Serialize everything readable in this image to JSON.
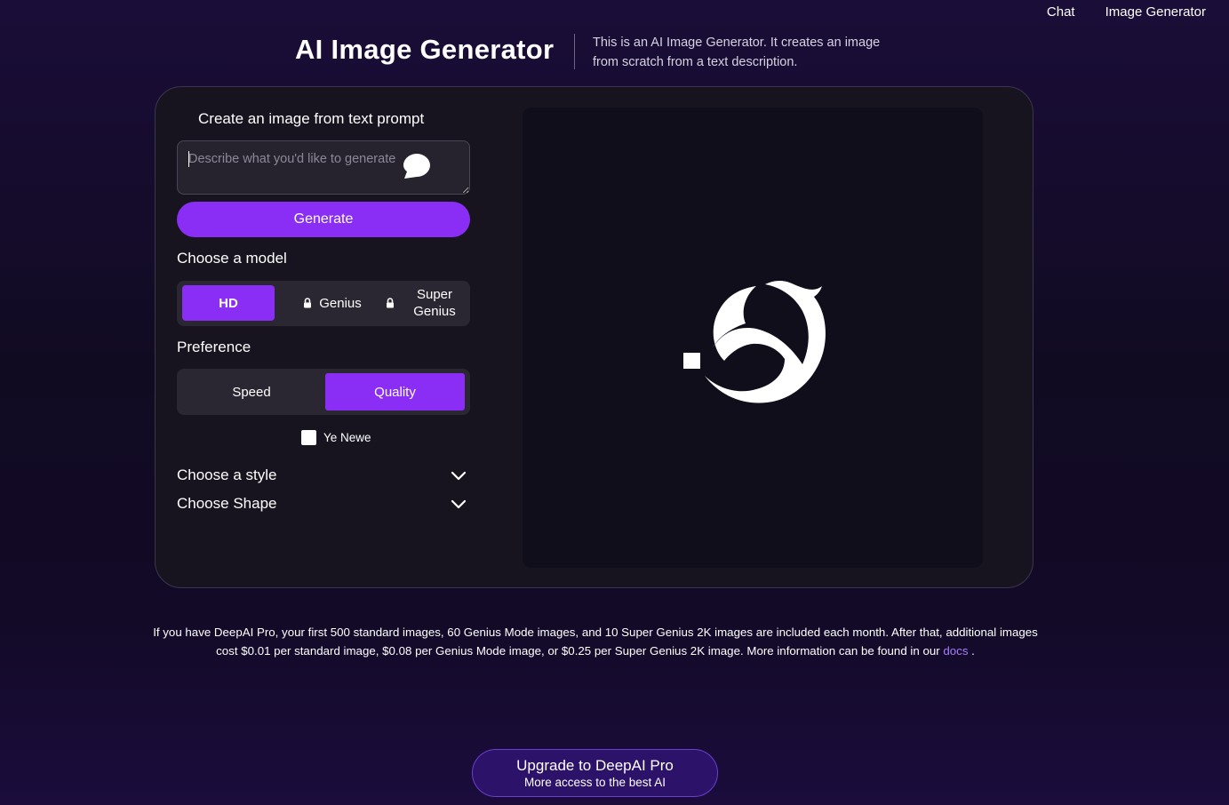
{
  "nav": {
    "chat": "Chat",
    "image_generator": "Image Generator"
  },
  "header": {
    "title": "AI Image Generator",
    "description": "This is an AI Image Generator. It creates an image from scratch from a text description."
  },
  "form": {
    "create_label": "Create an image from text prompt",
    "prompt_placeholder": "Describe what you'd like to generate",
    "generate_label": "Generate",
    "model_label": "Choose a model",
    "models": [
      {
        "label": "HD",
        "locked": false,
        "selected": true
      },
      {
        "label": "Genius",
        "locked": true,
        "selected": false
      },
      {
        "label": "Super Genius",
        "locked": true,
        "selected": false
      }
    ],
    "preference_label": "Preference",
    "preferences": [
      {
        "label": "Speed",
        "selected": false
      },
      {
        "label": "Quality",
        "selected": true
      }
    ],
    "checkbox_label": "Ye Newe",
    "checkbox_checked": false,
    "style_label": "Choose a style",
    "shape_label": "Choose Shape"
  },
  "footer": {
    "note": "If you have DeepAI Pro, your first 500 standard images, 60 Genius Mode images, and 10 Super Genius 2K images are included each month. After that, additional images cost $0.01 per standard image, $0.08 per Genius Mode image, or $0.25 per Super Genius 2K image. More information can be found in our",
    "docs_link": "docs",
    "note_end": ".",
    "upgrade_title": "Upgrade to DeepAI Pro",
    "upgrade_subtitle": "More access to the best AI"
  },
  "colors": {
    "accent": "#8a2ef5",
    "panel_bg": "#17141f",
    "link": "#a77bff"
  },
  "icons": [
    "lock-icon",
    "chevron-down-icon",
    "chat-bubble-icon",
    "deepai-logo"
  ]
}
